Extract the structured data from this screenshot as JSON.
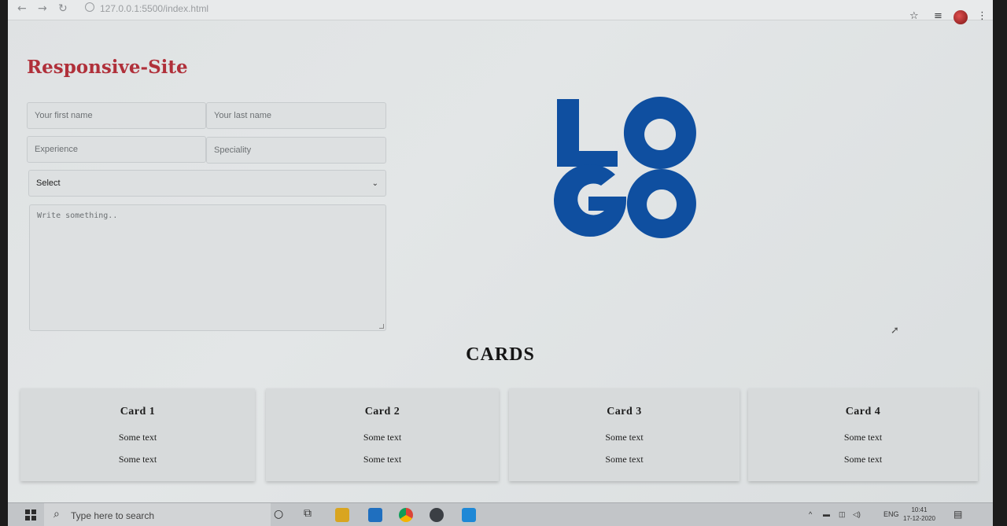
{
  "browser": {
    "url": "127.0.0.1:5500/index.html"
  },
  "page": {
    "title": "Responsive-Site",
    "form": {
      "first_name_placeholder": "Your first name",
      "last_name_placeholder": "Your last name",
      "experience_placeholder": "Experience",
      "speciality_placeholder": "Speciality",
      "select_value": "Select",
      "message_placeholder": "Write something.."
    },
    "logo": {
      "line1": "LO",
      "line2": "GO",
      "color": "#0f4fa0"
    },
    "cards_heading": "CARDS",
    "cards": [
      {
        "title": "Card 1",
        "text1": "Some text",
        "text2": "Some text"
      },
      {
        "title": "Card 2",
        "text1": "Some text",
        "text2": "Some text"
      },
      {
        "title": "Card 3",
        "text1": "Some text",
        "text2": "Some text"
      },
      {
        "title": "Card 4",
        "text1": "Some text",
        "text2": "Some text"
      }
    ]
  },
  "taskbar": {
    "search_placeholder": "Type here to search",
    "language": "ENG",
    "time": "10:41",
    "date": "17-12-2020"
  },
  "colors": {
    "title_red": "#b0303a",
    "logo_blue": "#0f4fa0"
  }
}
